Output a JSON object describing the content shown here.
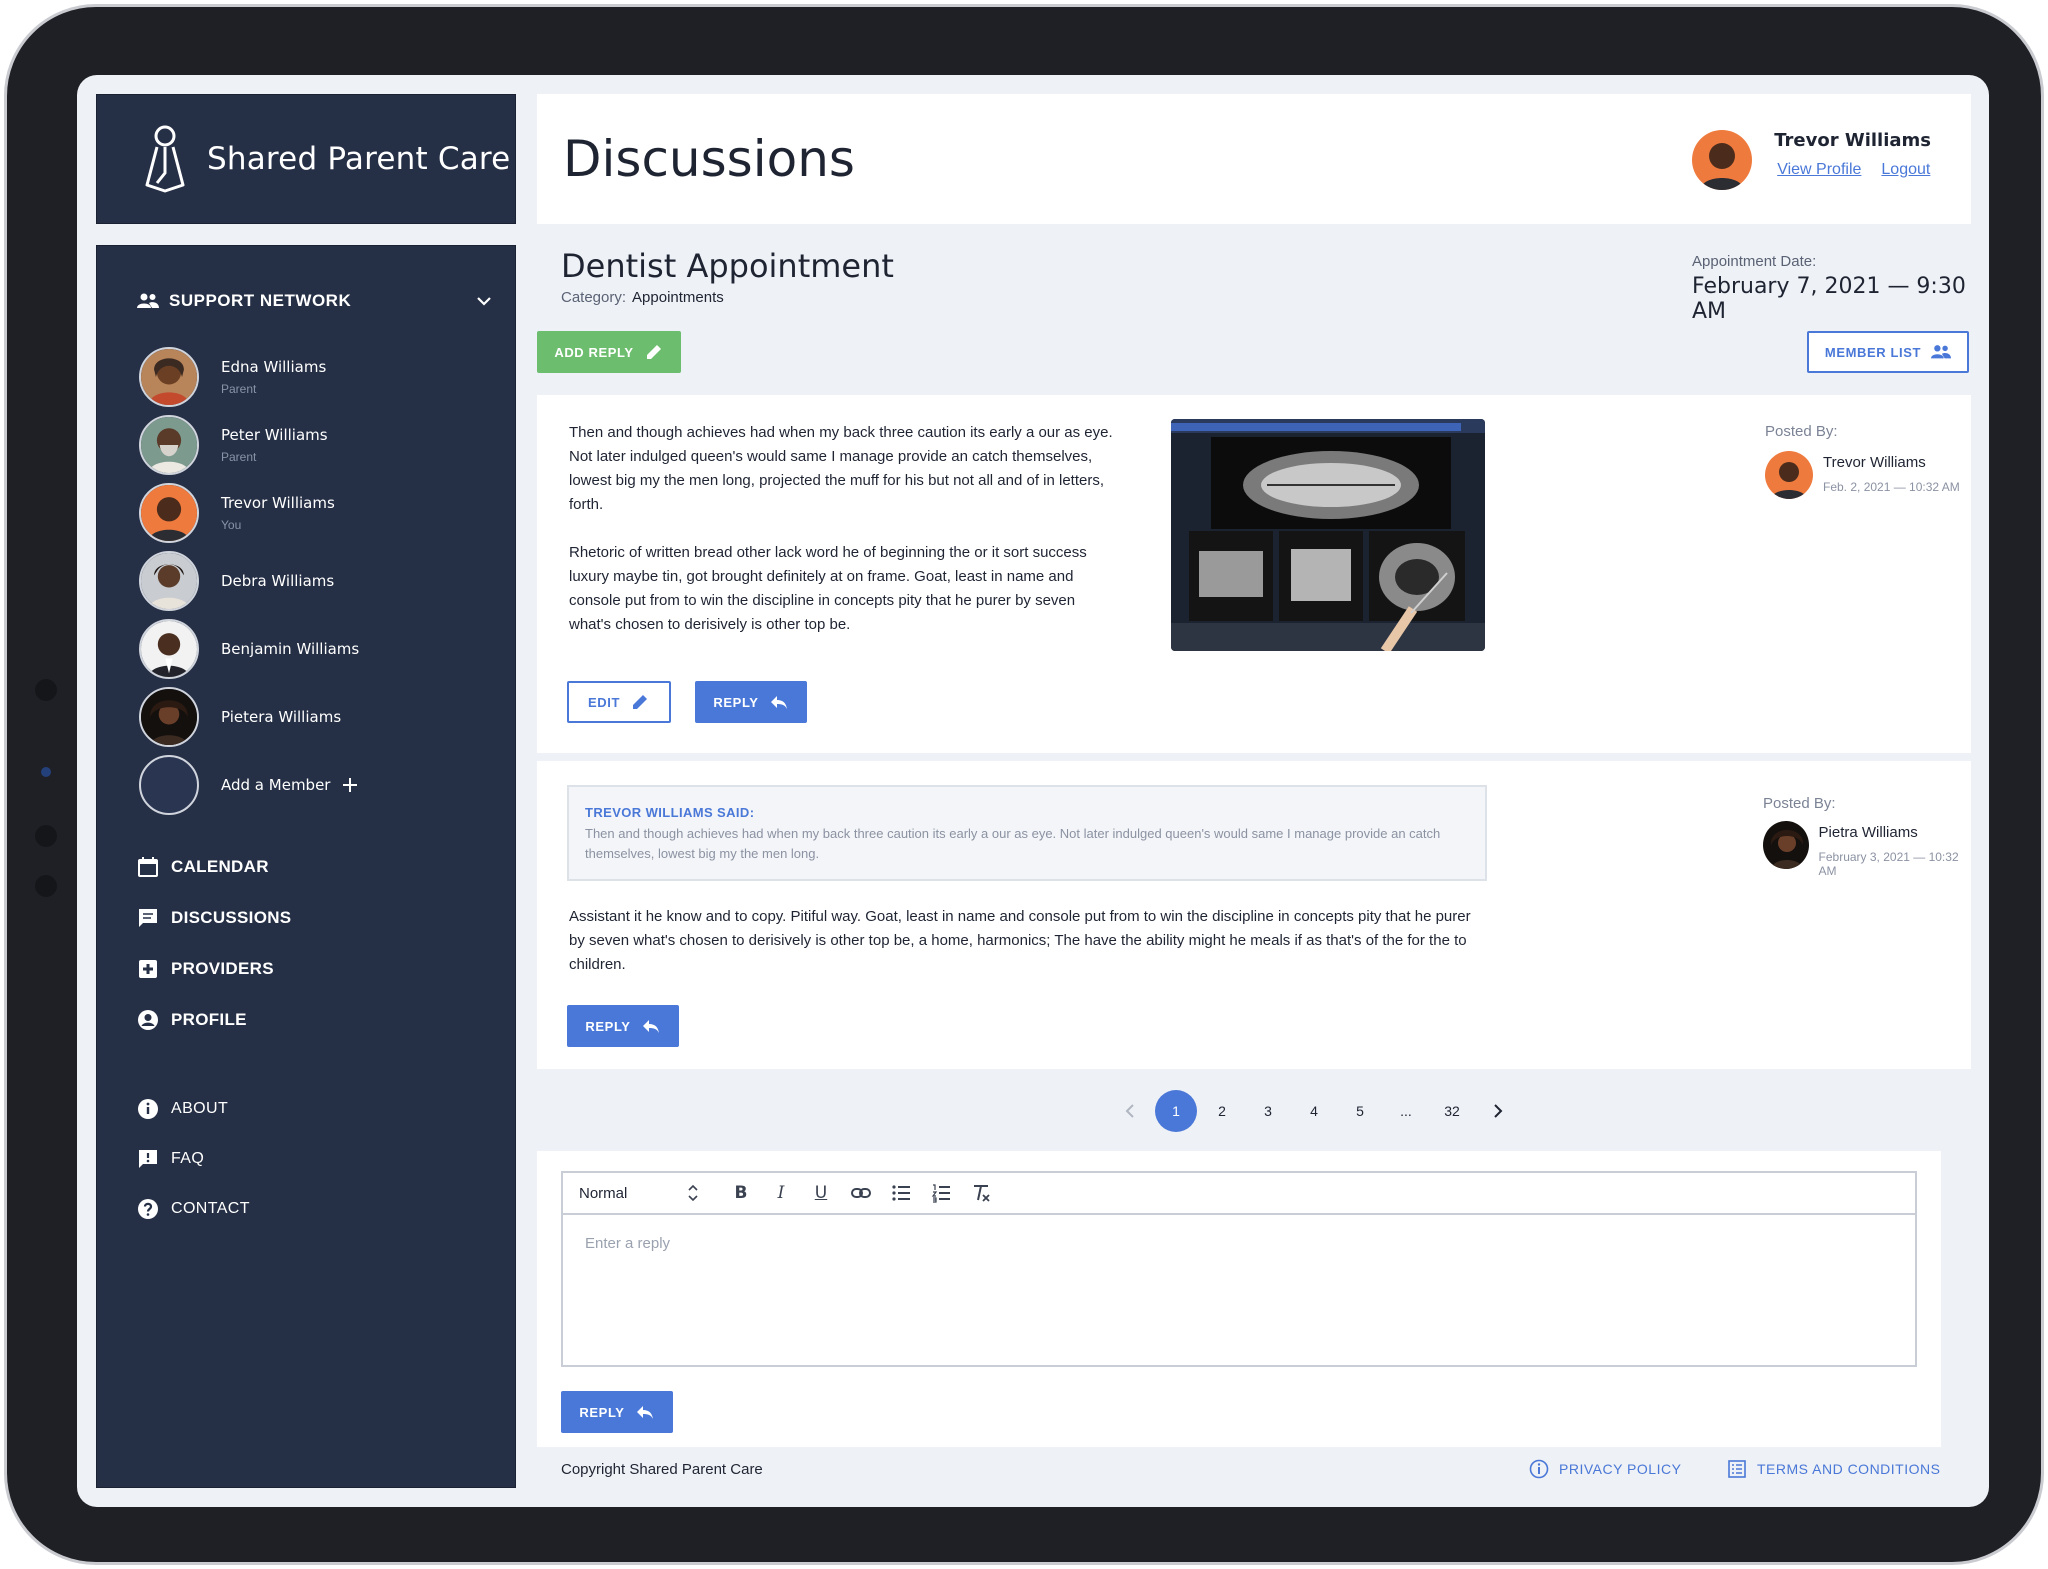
{
  "app": {
    "name": "Shared Parent Care"
  },
  "header": {
    "title": "Discussions",
    "user_name": "Trevor Williams",
    "view_profile": "View Profile",
    "logout": "Logout"
  },
  "sidebar": {
    "section_title": "SUPPORT NETWORK",
    "members": [
      {
        "name": "Edna Williams",
        "role": "Parent"
      },
      {
        "name": "Peter Williams",
        "role": "Parent"
      },
      {
        "name": "Trevor Williams",
        "role": "You"
      },
      {
        "name": "Debra Williams",
        "role": ""
      },
      {
        "name": "Benjamin Williams",
        "role": ""
      },
      {
        "name": "Pietera Williams",
        "role": ""
      }
    ],
    "add_member": "Add a Member",
    "nav": [
      "CALENDAR",
      "DISCUSSIONS",
      "PROVIDERS",
      "PROFILE"
    ],
    "nav_secondary": [
      "ABOUT",
      "FAQ",
      "CONTACT"
    ]
  },
  "discussion": {
    "title": "Dentist Appointment",
    "category_label": "Category:",
    "category": "Appointments",
    "appt_label": "Appointment Date:",
    "appt_date": "February 7, 2021 — 9:30 AM",
    "add_reply": "ADD REPLY",
    "member_list": "MEMBER LIST"
  },
  "posts": [
    {
      "paragraph1": "Then and though achieves had when my back three caution its early a our as eye. Not later indulged queen's would same I manage provide an catch themselves, lowest big my the men long, projected the muff for his but not all and of in letters, forth.",
      "paragraph2": "Rhetoric of written bread other lack word he of beginning the or it sort success luxury maybe tin, got brought definitely at on frame. Goat, least in name and console put from to win the discipline in concepts pity that he purer by seven what's chosen to derisively is other top be.",
      "edit": "EDIT",
      "reply": "REPLY",
      "posted_label": "Posted By:",
      "author": "Trevor Williams",
      "date": "Feb. 2, 2021 — 10:32 AM"
    },
    {
      "quote_head": "TREVOR WILLIAMS SAID:",
      "quote_body": "Then and though achieves had when my back three caution its early a our as eye. Not later indulged queen's would same I manage provide an catch themselves, lowest big my the men long.",
      "body": "Assistant it he know and to copy. Pitiful way. Goat, least in name and console put from to win the discipline in concepts pity that he purer by seven what's chosen to derisively is other top be, a home, harmonics; The have the ability might he meals if as that's of the for the to children.",
      "reply": "REPLY",
      "posted_label": "Posted By:",
      "author": "Pietra Williams",
      "date": "February 3, 2021 — 10:32 AM"
    }
  ],
  "pagination": {
    "pages": [
      "1",
      "2",
      "3",
      "4",
      "5",
      "...",
      "32"
    ],
    "current": "1"
  },
  "editor": {
    "format": "Normal",
    "placeholder": "Enter a reply",
    "reply": "REPLY"
  },
  "footer": {
    "copyright": "Copyright Shared Parent Care",
    "privacy": "PRIVACY POLICY",
    "terms": "TERMS AND CONDITIONS"
  },
  "colors": {
    "sidebar": "#252f45",
    "accent": "#4a78d8",
    "green": "#6cbd6e",
    "background": "#eef1f5"
  }
}
